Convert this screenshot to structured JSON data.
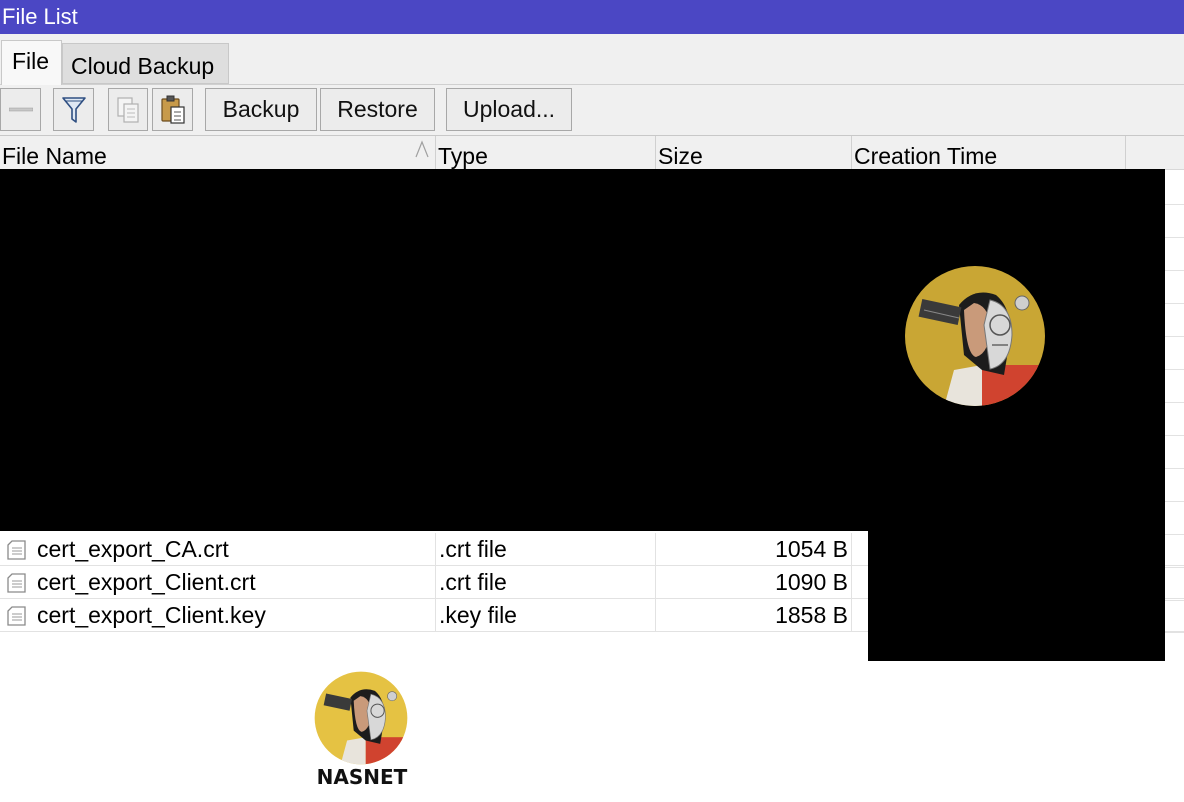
{
  "window": {
    "title": "File List"
  },
  "tabs": [
    {
      "label": "File",
      "active": true
    },
    {
      "label": "Cloud Backup",
      "active": false
    }
  ],
  "toolbar": {
    "remove_icon": "minus-icon",
    "filter_icon": "filter-funnel-icon",
    "copy_icon": "copy-icon",
    "paste_icon": "paste-clipboard-icon",
    "backup_label": "Backup",
    "restore_label": "Restore",
    "upload_label": "Upload..."
  },
  "table": {
    "columns": [
      "File Name",
      "Type",
      "Size",
      "Creation Time"
    ],
    "sorted_column": "File Name",
    "sort_icon": "sort-ascending-icon",
    "rows": [
      {
        "name": "cert_export_CA.crt",
        "type": ".crt file",
        "size": "1054 B",
        "time": ""
      },
      {
        "name": "cert_export_Client.crt",
        "type": ".crt file",
        "size": "1090 B",
        "time": ""
      },
      {
        "name": "cert_export_Client.key",
        "type": ".key file",
        "size": "1858 B",
        "time": ""
      }
    ]
  },
  "watermark": {
    "brand": "NASNET"
  },
  "colors": {
    "titlebar": "#4b47c4",
    "logo_gold": "#c9a634",
    "logo_red": "#d0432f"
  }
}
